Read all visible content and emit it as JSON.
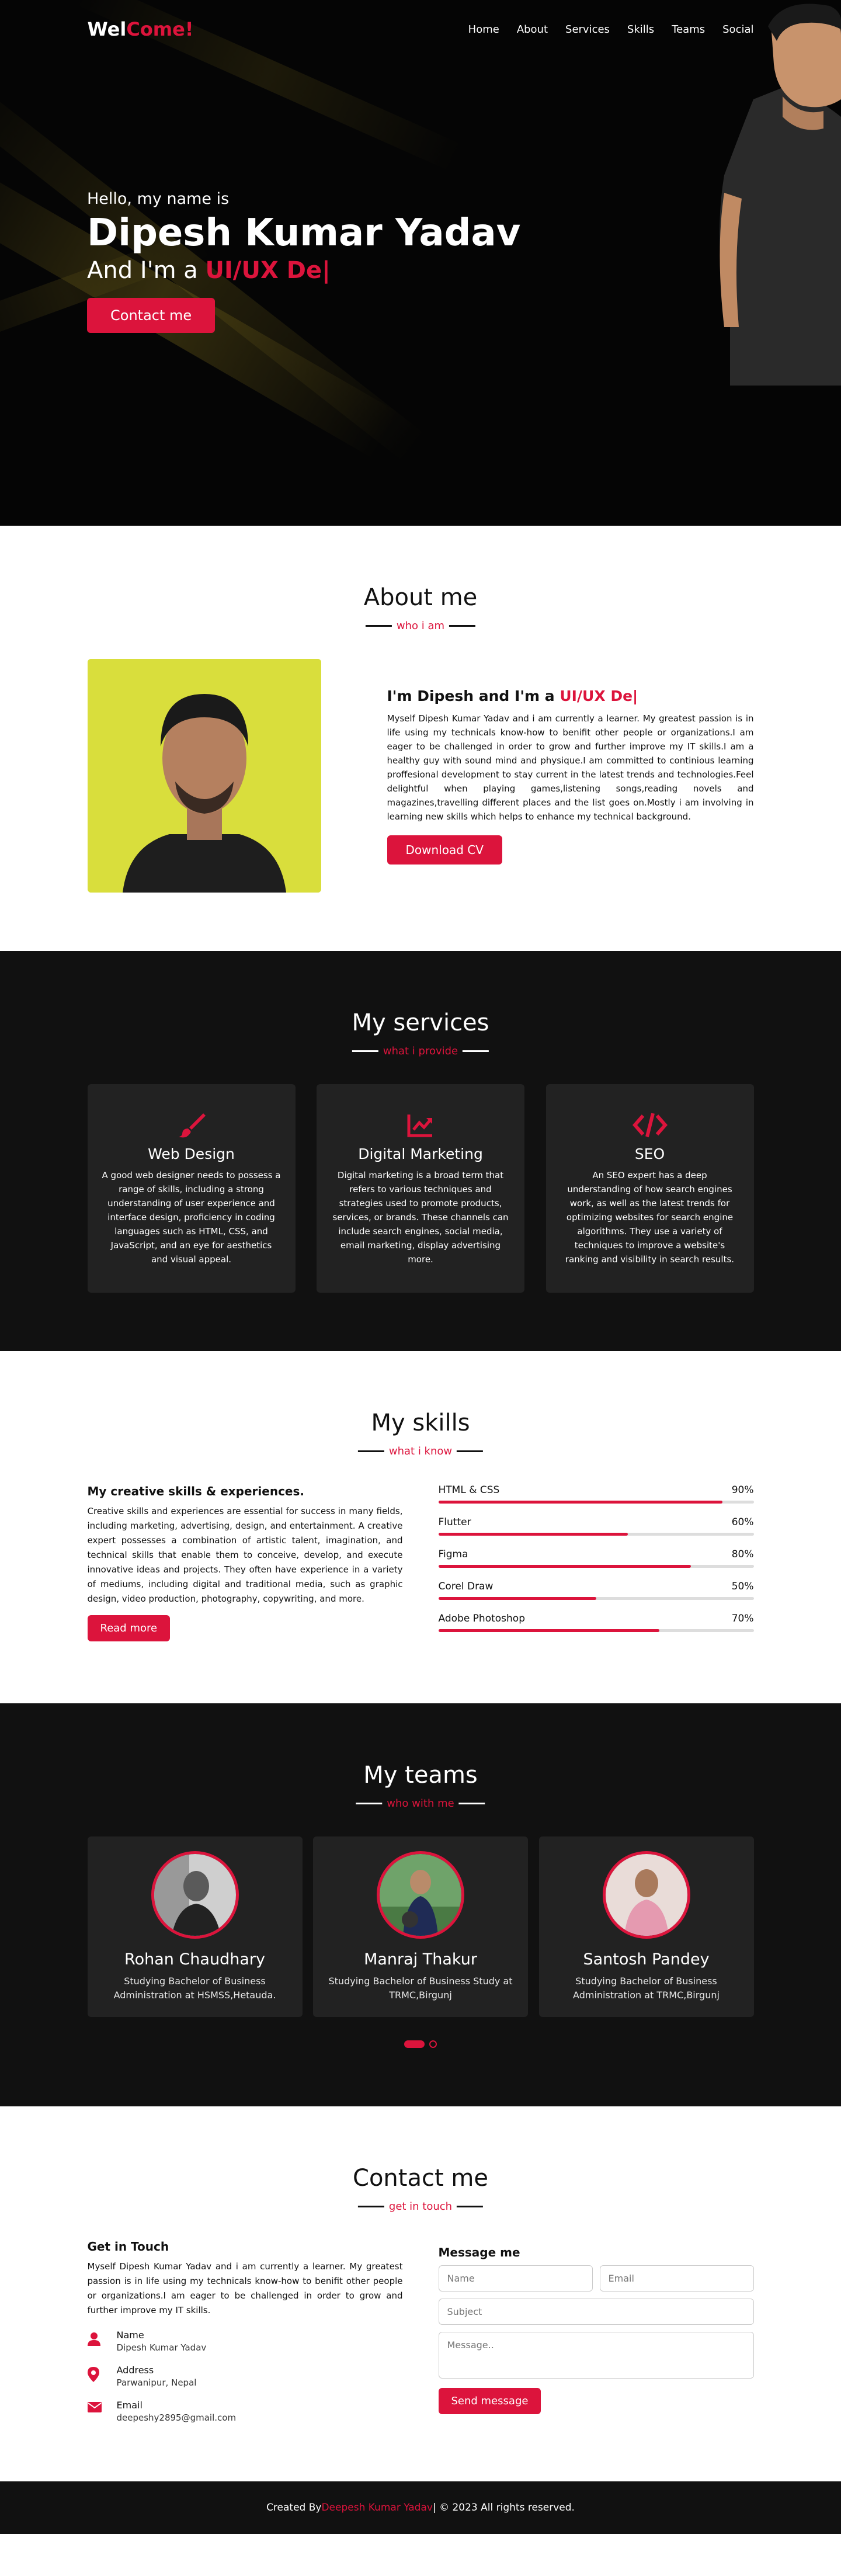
{
  "nav": {
    "logo_main": "Wel",
    "logo_accent": "Come!",
    "menu": [
      "Home",
      "About",
      "Services",
      "Skills",
      "Teams",
      "Social"
    ]
  },
  "home": {
    "hello": "Hello, my name is",
    "name": "Dipesh Kumar Yadav",
    "role_prefix": "And I'm a ",
    "role_typed": "UI/UX De|",
    "button": "Contact me"
  },
  "about": {
    "title": "About me",
    "subtitle": "who i am",
    "heading_prefix": "I'm Dipesh and I'm a ",
    "heading_typed": "UI/UX De|",
    "text": "Myself Dipesh Kumar Yadav and i am currently a learner. My greatest passion is in life using my technicals know-how to benifit other people or organizations.I am eager to be challenged in order to grow and further improve my IT skills.I am a healthy guy with sound mind and physique.I am committed to continious learning proffesional development to stay current in the latest trends and technologies.Feel delightful when playing games,listening songs,reading novels and magazines,travelling different places and the list goes on.Mostly i am involving in learning new skills which helps to enhance my technical background.",
    "button": "Download CV"
  },
  "services": {
    "title": "My services",
    "subtitle": "what i provide",
    "cards": [
      {
        "icon": "paint-brush-icon",
        "title": "Web Design",
        "text": "A good web designer needs to possess a range of skills, including a strong understanding of user experience and interface design, proficiency in coding languages such as HTML, CSS, and JavaScript, and an eye for aesthetics and visual appeal."
      },
      {
        "icon": "chart-line-icon",
        "title": "Digital Marketing",
        "text": "Digital marketing is a broad term that refers to various techniques and strategies used to promote products, services, or brands. These channels can include search engines, social media, email marketing, display advertising more."
      },
      {
        "icon": "code-icon",
        "title": "SEO",
        "text": "An SEO expert has a deep understanding of how search engines work, as well as the latest trends for optimizing websites for search engine algorithms. They use a variety of techniques to improve a website's ranking and visibility in search results."
      }
    ]
  },
  "skills": {
    "title": "My skills",
    "subtitle": "what i know",
    "heading": "My creative skills & experiences.",
    "text": "Creative skills and experiences are essential for success in many fields, including marketing, advertising, design, and entertainment. A creative expert possesses a combination of artistic talent, imagination, and technical skills that enable them to conceive, develop, and execute innovative ideas and projects. They often have experience in a variety of mediums, including digital and traditional media, such as graphic design, video production, photography, copywriting, and more.",
    "button": "Read more",
    "bars": [
      {
        "name": "HTML & CSS",
        "percent": "90%",
        "value": 90
      },
      {
        "name": "Flutter",
        "percent": "60%",
        "value": 60
      },
      {
        "name": "Figma",
        "percent": "80%",
        "value": 80
      },
      {
        "name": "Corel Draw",
        "percent": "50%",
        "value": 50
      },
      {
        "name": "Adobe Photoshop",
        "percent": "70%",
        "value": 70
      }
    ]
  },
  "teams": {
    "title": "My teams",
    "subtitle": "who with me",
    "members": [
      {
        "name": "Rohan Chaudhary",
        "text": "Studying Bachelor of Business Administration at HSMSS,Hetauda."
      },
      {
        "name": "Manraj Thakur",
        "text": "Studying Bachelor of Business Study at TRMC,Birgunj"
      },
      {
        "name": "Santosh Pandey",
        "text": "Studying Bachelor of Business Administration at TRMC,Birgunj"
      }
    ]
  },
  "contact": {
    "title": "Contact me",
    "subtitle": "get in touch",
    "get_in_touch": "Get in Touch",
    "text": "Myself Dipesh Kumar Yadav and i am currently a learner. My greatest passion is in life using my technicals know-how to benifit other people or organizations.I am eager to be challenged in order to grow and further improve my IT skills.",
    "info": [
      {
        "icon": "user-icon",
        "label": "Name",
        "value": "Dipesh Kumar Yadav"
      },
      {
        "icon": "map-marker-icon",
        "label": "Address",
        "value": "Parwanipur, Nepal"
      },
      {
        "icon": "envelope-icon",
        "label": "Email",
        "value": "deepeshy2895@gmail.com"
      }
    ],
    "message_heading": "Message me",
    "placeholders": {
      "name": "Name",
      "email": "Email",
      "subject": "Subject",
      "message": "Message.."
    },
    "button": "Send message"
  },
  "footer": {
    "prefix": "Created By ",
    "author": "Deepesh Kumar Yadav",
    "suffix": " | © 2023 All rights reserved."
  },
  "colors": {
    "accent": "#dc143c",
    "dark": "#111111",
    "card": "#222222"
  }
}
